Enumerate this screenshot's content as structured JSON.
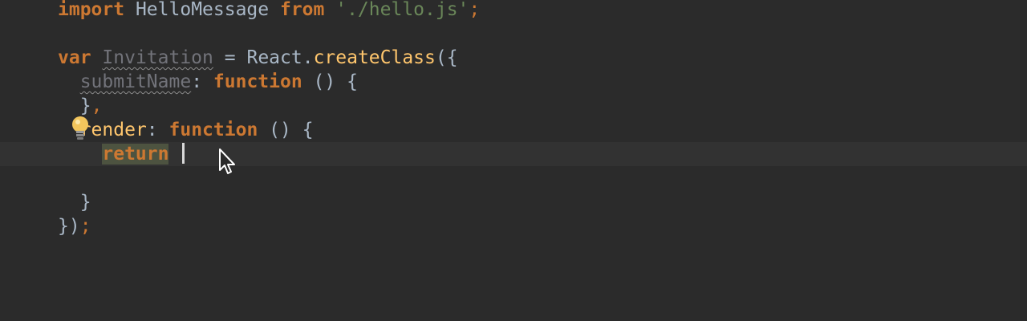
{
  "editor": {
    "lines": {
      "l0": {
        "kw1": "import",
        "name": "HelloMessage",
        "kw2": "from",
        "str": "'./hello.js'",
        "semi": ";"
      },
      "l2": {
        "kw": "var",
        "name": "Invitation",
        "eq": "=",
        "obj": "React.",
        "fn": "createClass",
        "open": "({"
      },
      "l3": {
        "prop": "submitName",
        "colon": ":",
        "kw": "function",
        "rest": "() {"
      },
      "l4": {
        "close": "}",
        "comma": ","
      },
      "l5": {
        "prop": "render",
        "colon": ":",
        "kw": "function",
        "rest": "() {"
      },
      "l6": {
        "kw": "return"
      },
      "l8": {
        "close": "}"
      },
      "l9": {
        "close": "})",
        "semi": ";"
      }
    },
    "colors": {
      "background": "#2b2b2b",
      "current_line": "#323232",
      "keyword": "#cc7832",
      "string": "#6a8759",
      "method": "#ffc66d",
      "text": "#a9b7c6",
      "unused": "#72737a"
    },
    "icons": {
      "intention": "lightbulb-icon",
      "pointer": "mouse-pointer-icon"
    }
  }
}
